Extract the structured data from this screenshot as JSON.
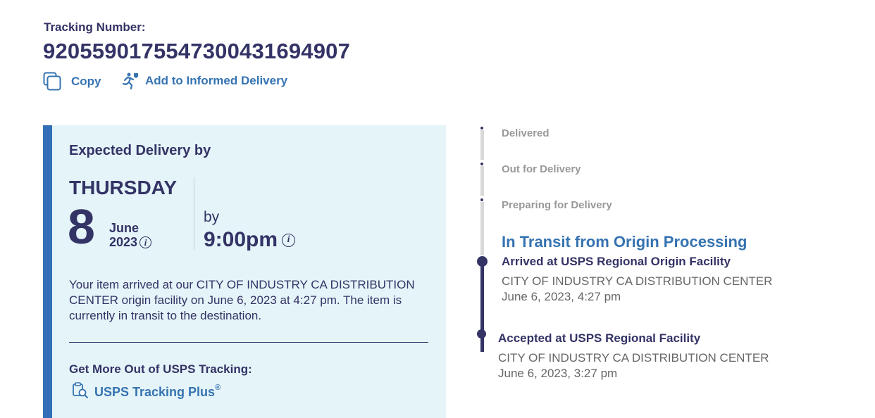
{
  "tracking": {
    "label": "Tracking Number:",
    "number": "9205590175547300431694907",
    "copy_label": "Copy",
    "informed_label": "Add to Informed Delivery"
  },
  "delivery": {
    "title": "Expected Delivery by",
    "day": "THURSDAY",
    "date": "8",
    "month": "June",
    "year": "2023",
    "by_label": "by",
    "time": "9:00pm",
    "description": "Your item arrived at our CITY OF INDUSTRY CA DISTRIBUTION CENTER origin facility on June 6, 2023 at 4:27 pm. The item is currently in transit to the destination.",
    "more_title": "Get More Out of USPS Tracking:",
    "plus_label": "USPS Tracking Plus",
    "plus_mark": "®"
  },
  "timeline": {
    "steps": [
      "Delivered",
      "Out for Delivery",
      "Preparing for Delivery"
    ],
    "current_stage": "In Transit from Origin Processing",
    "events": [
      {
        "title": "Arrived at USPS Regional Origin Facility",
        "location": "CITY OF INDUSTRY CA DISTRIBUTION CENTER",
        "datetime": "June 6, 2023, 4:27 pm"
      },
      {
        "title": "Accepted at USPS Regional Facility",
        "location": "CITY OF INDUSTRY CA DISTRIBUTION CENTER",
        "datetime": "June 6, 2023, 3:27 pm"
      }
    ]
  },
  "icons": {
    "copy": "copy-icon",
    "informed": "informed-delivery-icon",
    "info": "info-icon",
    "tracking_plus": "tracking-plus-icon"
  },
  "colors": {
    "navy": "#333366",
    "link_blue": "#3573b1",
    "card_bg": "#e5f4f8",
    "card_accent": "#336fb6",
    "muted": "#999999"
  }
}
